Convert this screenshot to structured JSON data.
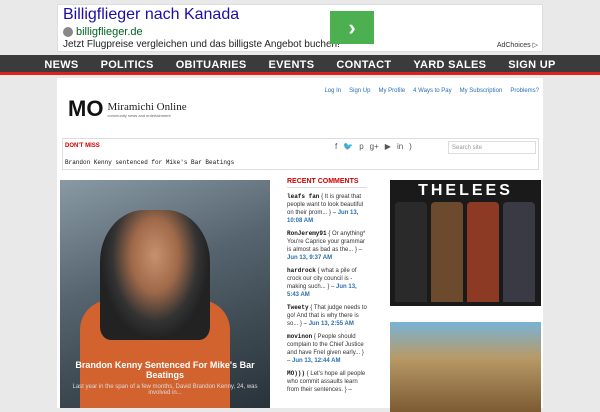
{
  "ad": {
    "title": "Billigflieger nach Kanada",
    "url": "billigflieger.de",
    "description": "Jetzt Flugpreise vergleichen und das billigste Angebot buchen!",
    "choices": "AdChoices ▷"
  },
  "nav": {
    "items": [
      "NEWS",
      "POLITICS",
      "OBITUARIES",
      "EVENTS",
      "CONTACT",
      "YARD SALES",
      "SIGN UP"
    ]
  },
  "header": {
    "logo_mark": "MO",
    "logo_name": "Miramichi Online",
    "logo_tagline": "community news and entertainment",
    "toplinks": [
      "Log In",
      "Sign Up",
      "My Profile",
      "4 Ways to Pay",
      "My Subscription",
      "Problems?"
    ]
  },
  "dontmiss": {
    "label": "DON'T MISS",
    "headline": "Brandon Kenny sentenced for Mike's Bar Beatings",
    "search_placeholder": "Search site"
  },
  "feature": {
    "title": "Brandon Kenny Sentenced For Mike's Bar Beatings",
    "excerpt": "Last year in the span of a few months, David Brandon Kenny, 24, was involved in..."
  },
  "recent": {
    "heading": "RECENT COMMENTS",
    "items": [
      {
        "who": "leafs fan",
        "text": "{ It is great that people want to look beautiful on their prom... } –",
        "when": "Jun 13, 10:08 AM"
      },
      {
        "who": "RonJeremy91",
        "text": "{ Or anything* You're Caprice your grammar is almost as bad as the... } –",
        "when": "Jun 13, 9:37 AM"
      },
      {
        "who": "hardrock",
        "text": "{ what a pile of crock our city council is - making such... } –",
        "when": "Jun 13, 5:43 AM"
      },
      {
        "who": "Tweety",
        "text": "{ That judge needs to go! And that is why there is so... } –",
        "when": "Jun 13, 2:55 AM"
      },
      {
        "who": "movinon",
        "text": "{ People should complain to the Chief Justice and have Fnel given early... } –",
        "when": "Jun 13, 12:44 AM"
      },
      {
        "who": "MO)))",
        "text": "{ Let's hope all people who commit assaults learn from their sentences. } –",
        "when": ""
      }
    ]
  },
  "sidebar_ad": {
    "brand": "THELEES"
  },
  "colors": {
    "nav_bg": "#3b3b3b",
    "nav_accent": "#e02020",
    "link": "#2a6fb0",
    "red_label": "#cc0000"
  }
}
